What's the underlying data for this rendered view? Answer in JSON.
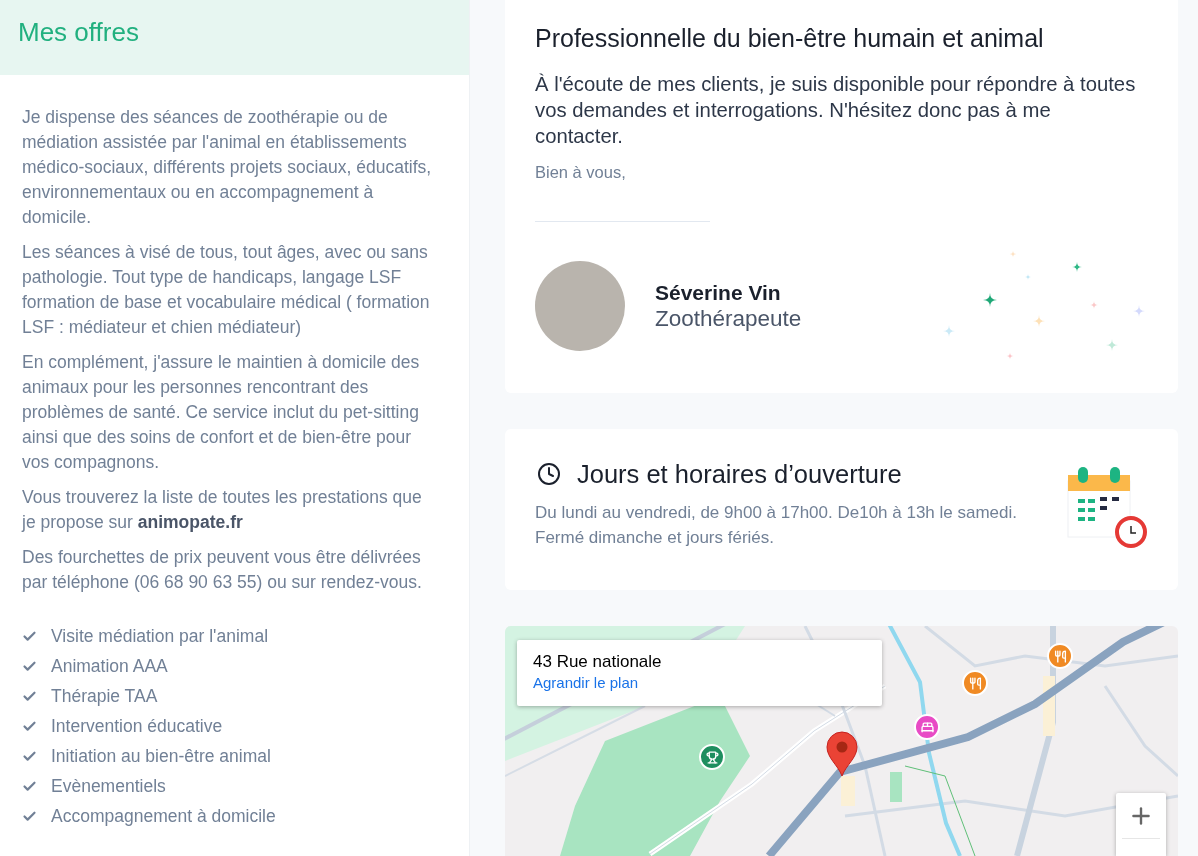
{
  "offers": {
    "title": "Mes offres",
    "paragraphs": [
      "Je dispense des séances de zoothérapie ou de médiation assistée par l'animal en établissements médico-sociaux, différents projets sociaux, éducatifs, environnementaux ou en accompagnement à domicile.",
      "Les séances à visé de tous, tout âges, avec ou sans pathologie. Tout type de handicaps, langage LSF formation de base et vocabulaire médical ( formation LSF : médiateur et chien médiateur)",
      "En complément, j'assure le maintien à domicile des animaux pour les personnes rencontrant des problèmes de santé. Ce service inclut du pet-sitting ainsi que des soins de confort et de bien-être pour vos compagnons.",
      "Vous trouverez la liste de toutes les prestations que je propose sur **animopate.fr**",
      "Des fourchettes de prix peuvent vous être délivrées par téléphone (06 68 90 63 55) ou sur rendez-vous."
    ],
    "services": [
      "Visite médiation par l'animal",
      "Animation AAA",
      "Thérapie TAA",
      "Intervention éducative",
      "Initiation au bien-être animal",
      "Evènementiels",
      "Accompagnement à domicile"
    ]
  },
  "intro_card": {
    "title": "Professionnelle du bien-être humain et animal",
    "message": "À l'écoute de mes clients, je suis disponible pour répondre à toutes vos demandes et interrogations. N'hésitez donc pas à me contacter.",
    "closing": "Bien à vous,",
    "person": {
      "name": "Séverine Vin",
      "role": "Zoothérapeute"
    }
  },
  "hours_card": {
    "title": "Jours et horaires d’ouverture",
    "text": "Du lundi au vendredi, de 9h00 à 17h00. De10h à 13h le samedi. Fermé dimanche et jours fériés."
  },
  "map": {
    "address": "43 Rue nationale",
    "link": "Agrandir le plan"
  }
}
